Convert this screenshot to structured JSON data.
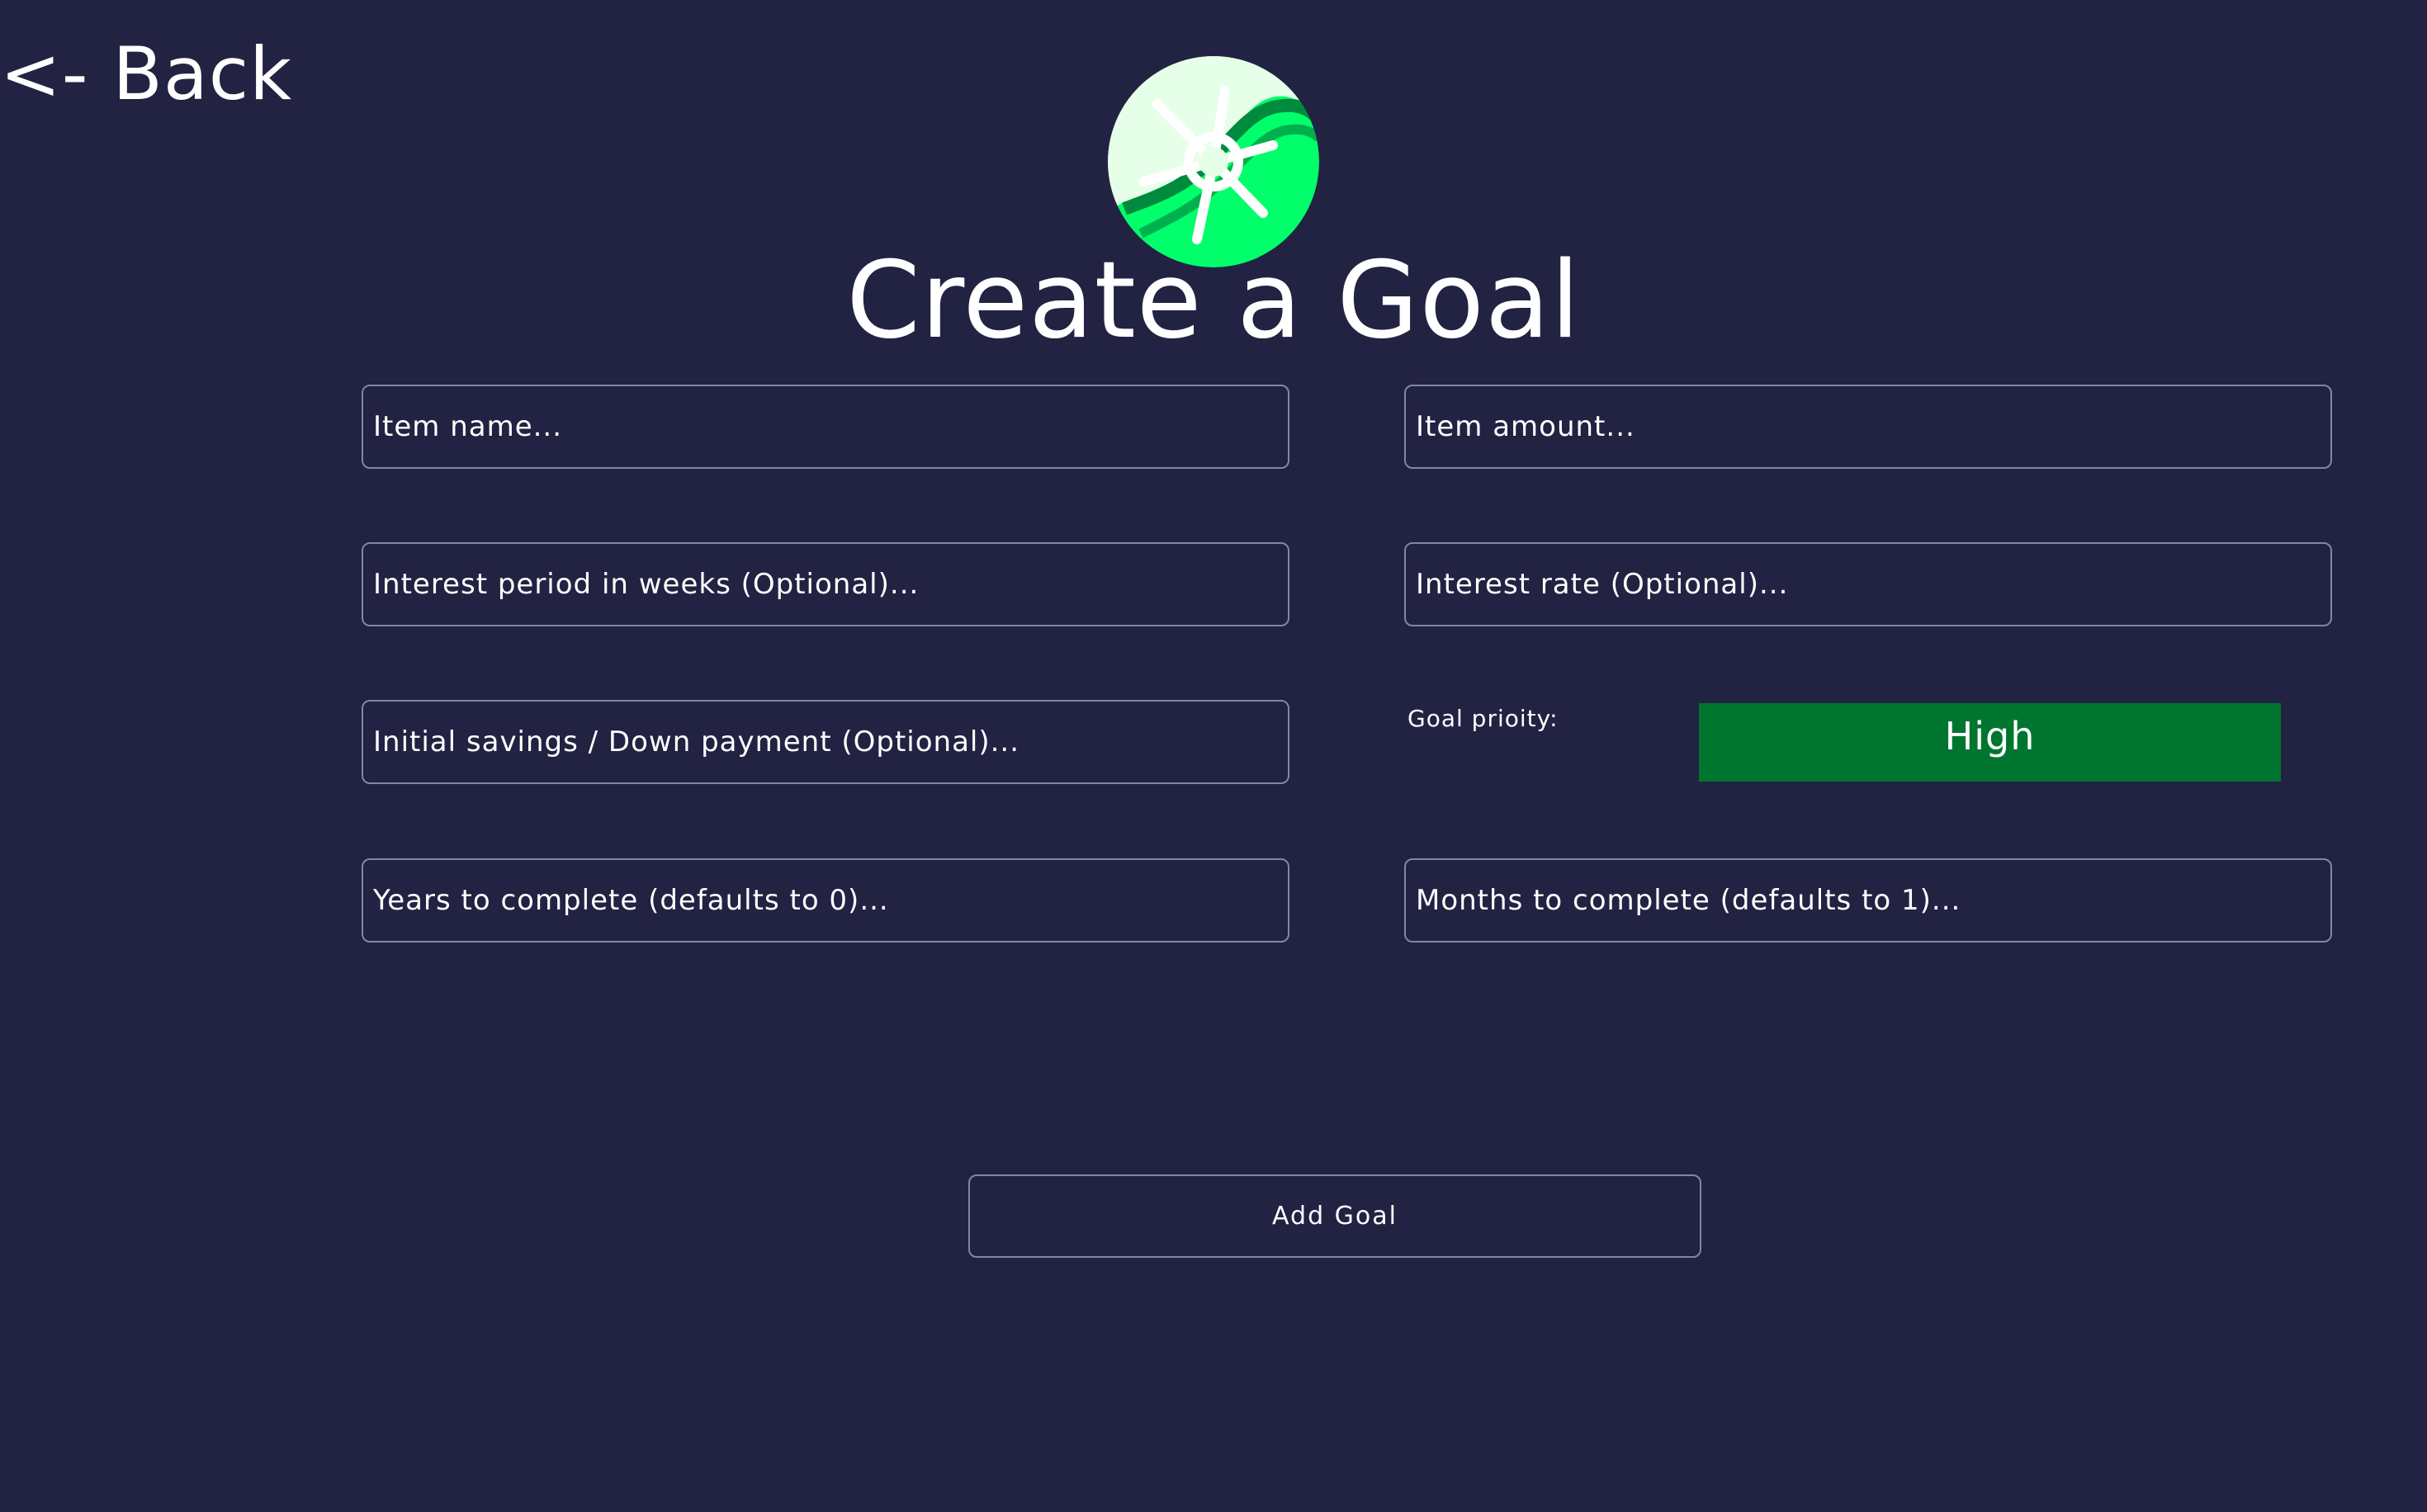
{
  "nav": {
    "back_label": "<- Back"
  },
  "header": {
    "logo_icon": "ship-wheel-wave-icon",
    "title": "Create a Goal"
  },
  "form": {
    "item_name": {
      "value": "",
      "placeholder": "Item name..."
    },
    "item_amount": {
      "value": "",
      "placeholder": "Item amount..."
    },
    "interest_period": {
      "value": "",
      "placeholder": "Interest period in weeks (Optional)..."
    },
    "interest_rate": {
      "value": "",
      "placeholder": "Interest rate (Optional)..."
    },
    "initial_savings": {
      "value": "",
      "placeholder": "Initial savings / Down payment (Optional)..."
    },
    "priority": {
      "label": "Goal prioity:",
      "value": "High",
      "color": "#00752f"
    },
    "years": {
      "value": "",
      "placeholder": "Years to complete (defaults to 0)..."
    },
    "months": {
      "value": "",
      "placeholder": "Months to complete (defaults to 1)..."
    },
    "submit_label": "Add Goal"
  },
  "colors": {
    "background": "#222242",
    "border": "#7f8a99",
    "accent_green": "#00ff6a",
    "priority_green": "#00752f"
  }
}
